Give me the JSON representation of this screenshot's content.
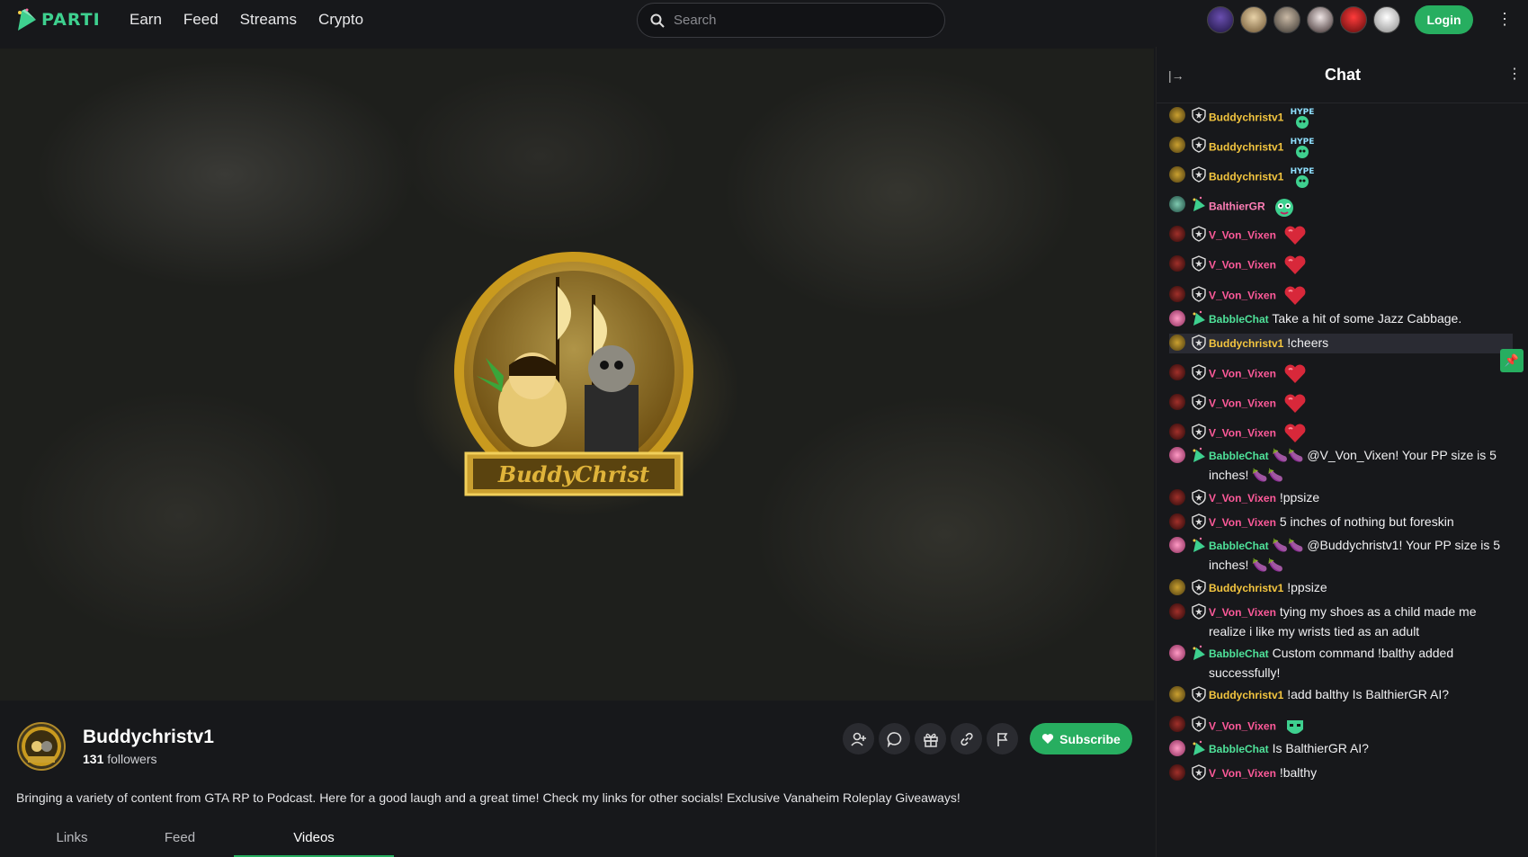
{
  "header": {
    "logo_text": "PARTI",
    "nav": [
      "Earn",
      "Feed",
      "Streams",
      "Crypto"
    ],
    "search_placeholder": "Search",
    "login_label": "Login"
  },
  "channel": {
    "name": "Buddychristv1",
    "followers_count": "131",
    "followers_label": "followers",
    "subscribe_label": "Subscribe",
    "description": "Bringing a variety of content from GTA RP to Podcast. Here for a good laugh and a great time! Check my links for other socials! Exclusive Vanaheim Roleplay Giveaways!",
    "tabs": [
      "Links",
      "Feed",
      "Videos"
    ],
    "active_tab": "Videos",
    "emblem_text": "BuddyChrist"
  },
  "chat": {
    "title": "Chat",
    "messages": [
      {
        "user": "Buddychristv1",
        "text": "",
        "emote": "hype"
      },
      {
        "user": "Buddychristv1",
        "text": "",
        "emote": "hype"
      },
      {
        "user": "Buddychristv1",
        "text": "",
        "emote": "hype"
      },
      {
        "user": "BalthierGR",
        "text": "",
        "emote": "face"
      },
      {
        "user": "V_Von_Vixen",
        "text": "",
        "emote": "heart"
      },
      {
        "user": "V_Von_Vixen",
        "text": "",
        "emote": "heart"
      },
      {
        "user": "V_Von_Vixen",
        "text": "",
        "emote": "heart"
      },
      {
        "user": "BabbleChat",
        "text": "Take a hit of some Jazz Cabbage."
      },
      {
        "user": "Buddychristv1",
        "text": "!cheers"
      },
      {
        "user": "V_Von_Vixen",
        "text": "",
        "emote": "heart"
      },
      {
        "user": "V_Von_Vixen",
        "text": "",
        "emote": "heart"
      },
      {
        "user": "V_Von_Vixen",
        "text": "",
        "emote": "heart"
      },
      {
        "user": "BabbleChat",
        "text": "🍆🍆 @V_Von_Vixen! Your PP size is 5 inches! 🍆🍆"
      },
      {
        "user": "V_Von_Vixen",
        "text": "!ppsize"
      },
      {
        "user": "V_Von_Vixen",
        "text": "5 inches of nothing but foreskin"
      },
      {
        "user": "BabbleChat",
        "text": "🍆🍆 @Buddychristv1! Your PP size is 5 inches! 🍆🍆"
      },
      {
        "user": "Buddychristv1",
        "text": "!ppsize"
      },
      {
        "user": "V_Von_Vixen",
        "text": "tying my shoes as a child made me realize i like my wrists tied as an adult"
      },
      {
        "user": "BabbleChat",
        "text": "Custom command !balthy added successfully!"
      },
      {
        "user": "Buddychristv1",
        "text": "!add balthy Is BalthierGR AI?"
      },
      {
        "user": "V_Von_Vixen",
        "text": "",
        "emote": "face-green"
      },
      {
        "user": "BabbleChat",
        "text": "Is BalthierGR AI?"
      },
      {
        "user": "V_Von_Vixen",
        "text": "!balthy"
      }
    ]
  },
  "colors": {
    "accent": "#27ae60",
    "buddy": "#f3c53f",
    "vixen": "#ff5a9a",
    "babble": "#4fe39a",
    "balthier": "#ff7eb6"
  }
}
